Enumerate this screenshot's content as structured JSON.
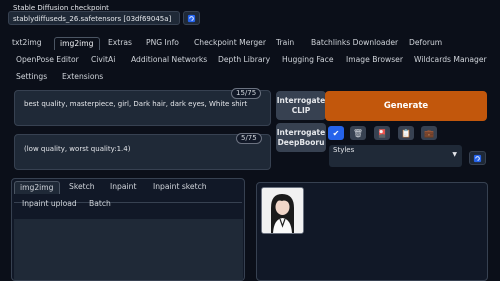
{
  "checkpoint": {
    "label": "Stable Diffusion checkpoint",
    "value": "stablydiffuseds_26.safetensors [03df69045a]",
    "refresh_icon": "refresh-icon"
  },
  "tabs_row1": [
    "txt2img",
    "img2img",
    "Extras",
    "PNG Info",
    "Checkpoint Merger",
    "Train",
    "Batchlinks Downloader",
    "Deforum"
  ],
  "tabs_row2": [
    "OpenPose Editor",
    "CivitAi",
    "Additional Networks",
    "Depth Library",
    "Hugging Face",
    "Image Browser",
    "Wildcards Manager"
  ],
  "tabs_row3": [
    "Settings",
    "Extensions"
  ],
  "active_tab": "img2img",
  "prompt": {
    "positive": "best quality, masterpiece, girl, Dark hair, dark eyes, White shirt",
    "positive_count": "15/75",
    "negative": "(low quality, worst quality:1.4)",
    "negative_count": "5/75"
  },
  "interrogate_clip": {
    "line1": "Interrogate",
    "line2": "CLIP"
  },
  "interrogate_deepbooru": {
    "line1": "Interrogate",
    "line2": "DeepBooru"
  },
  "generate_label": "Generate",
  "styles_label": "Styles",
  "accent_color": "#c2570c",
  "img_tabs_row1": [
    "img2img",
    "Sketch",
    "Inpaint",
    "Inpaint sketch"
  ],
  "img_tabs_row2": [
    "Inpaint upload",
    "Batch"
  ]
}
